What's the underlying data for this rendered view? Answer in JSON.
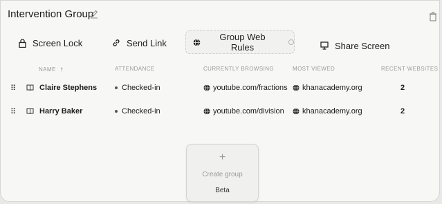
{
  "group": {
    "title": "Intervention Group"
  },
  "toolbar": {
    "screen_lock": "Screen Lock",
    "send_link": "Send Link",
    "group_web_rules": "Group Web Rules",
    "share_screen": "Share Screen"
  },
  "table": {
    "columns": {
      "name": "NAME",
      "attendance": "ATTENDANCE",
      "browsing": "CURRENTLY BROWSING",
      "viewed": "MOST VIEWED",
      "recent": "RECENT WEBSITES"
    },
    "sort_indicator": "↑",
    "rows": [
      {
        "name": "Claire Stephens",
        "attendance": "Checked-in",
        "browsing": "youtube.com/fractions",
        "viewed": "khanacademy.org",
        "recent": "2"
      },
      {
        "name": "Harry Baker",
        "attendance": "Checked-in",
        "browsing": "youtube.com/division",
        "viewed": "khanacademy.org",
        "recent": "2"
      }
    ]
  },
  "create_group": {
    "plus": "+",
    "label": "Create group",
    "badge": "Beta"
  },
  "icons": {
    "edit": "pencil-icon",
    "delete": "trash-icon",
    "lock": "lock-icon",
    "link": "link-icon",
    "globe": "globe-icon",
    "monitor": "monitor-icon",
    "book": "book-icon",
    "drag": "drag-handle-icon"
  }
}
